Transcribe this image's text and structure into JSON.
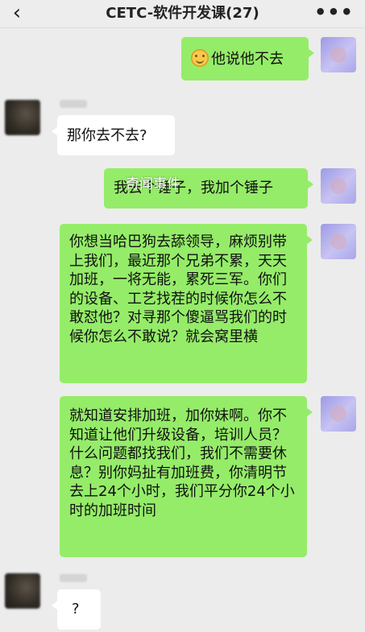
{
  "header": {
    "back_icon": "chevron-left-icon",
    "title": "CETC-软件开发课(27)",
    "more_icon": "more-dots-icon",
    "more_glyph": "•••"
  },
  "watermark": "奇闻事件",
  "messages": [
    {
      "side": "right",
      "emoji": "smile-emoji",
      "text": "他说他不去"
    },
    {
      "side": "left",
      "text": "那你去不去?"
    },
    {
      "side": "right",
      "text": "我去个锤子，我加个锤子"
    },
    {
      "side": "right",
      "text": "你想当哈巴狗去舔领导，麻烦别带上我们，最近那个兄弟不累，天天加班，一将无能，累死三军。你们的设备、工艺找茬的时候你怎么不敢怼他？对寻那个傻逼骂我们的时候你怎么不敢说？就会窝里横"
    },
    {
      "side": "right",
      "text": "就知道安排加班，加你妹啊。你不知道让他们升级设备，培训人员？什么问题都找我们，我们不需要休息？别你妈扯有加班费，你清明节去上24个小时，我们平分你24个小时的加班时间"
    },
    {
      "side": "left",
      "text": "?"
    }
  ]
}
